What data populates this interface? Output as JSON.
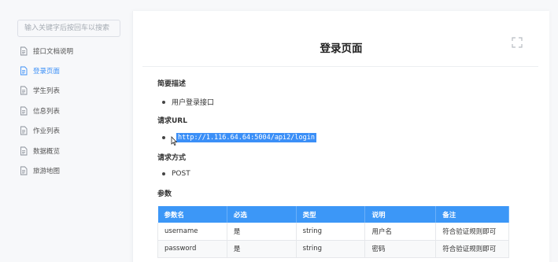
{
  "sidebar": {
    "search_placeholder": "输入关键字后按回车以搜索",
    "items": [
      {
        "label": "接口文档说明",
        "active": false
      },
      {
        "label": "登录页面",
        "active": true
      },
      {
        "label": "学生列表",
        "active": false
      },
      {
        "label": "信息列表",
        "active": false
      },
      {
        "label": "作业列表",
        "active": false
      },
      {
        "label": "数据概览",
        "active": false
      },
      {
        "label": "旅游地图",
        "active": false
      }
    ]
  },
  "page": {
    "title": "登录页面",
    "fullscreen_icon": "fullscreen-icon",
    "sections": {
      "summary_heading": "简要描述",
      "summary_item": "用户登录接口",
      "url_heading": "请求URL",
      "url_value": "http://1.116.64.64:5004/api2/login",
      "method_heading": "请求方式",
      "method_value": "POST",
      "params_heading": "参数"
    },
    "table": {
      "headers": [
        "参数名",
        "必选",
        "类型",
        "说明",
        "备注"
      ],
      "rows": [
        [
          "username",
          "是",
          "string",
          "用户名",
          "符合验证规则即可"
        ],
        [
          "password",
          "是",
          "string",
          "密码",
          "符合验证规则即可"
        ]
      ]
    }
  },
  "colors": {
    "accent": "#3b8ff7",
    "table_header": "#3c97f7",
    "selection": "#3b8ff7"
  }
}
